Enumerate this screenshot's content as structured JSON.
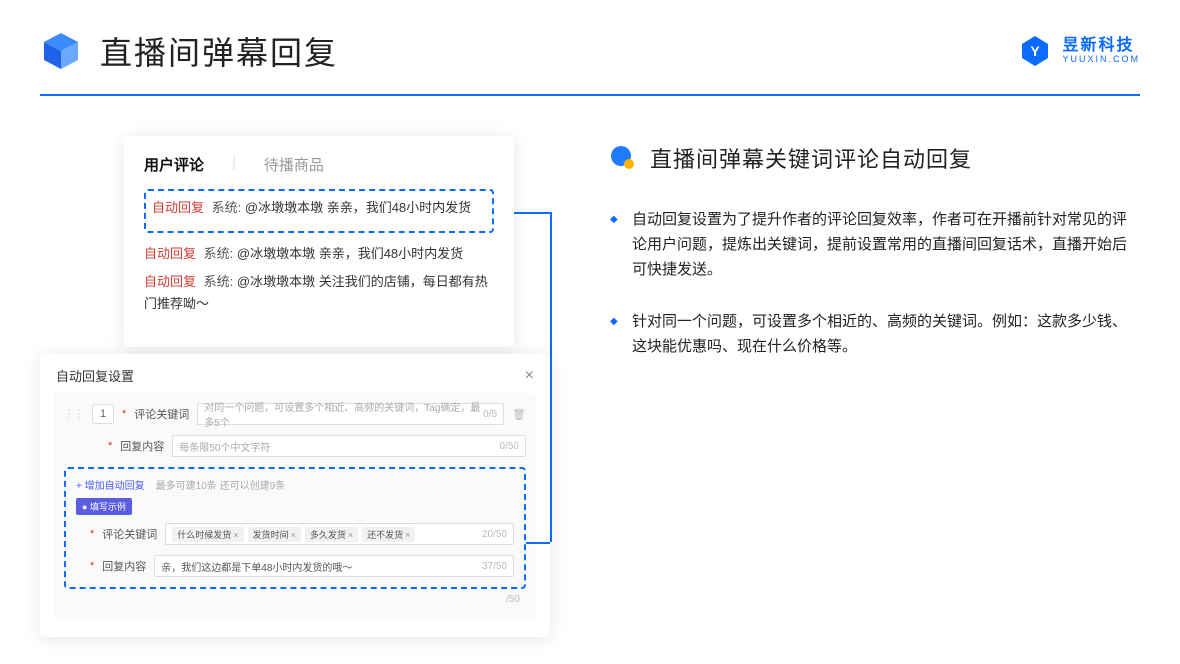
{
  "header": {
    "title": "直播间弹幕回复",
    "brand_name": "昱新科技",
    "brand_sub": "YUUXIN.COM"
  },
  "right": {
    "section_title": "直播间弹幕关键词评论自动回复",
    "bullet1": "自动回复设置为了提升作者的评论回复效率，作者可在开播前针对常见的评论用户问题，提炼出关键词，提前设置常用的直播间回复话术，直播开始后可快捷发送。",
    "bullet2": "针对同一个问题，可设置多个相近的、高频的关键词。例如：这款多少钱、这块能优惠吗、现在什么价格等。"
  },
  "comments": {
    "tab_active": "用户评论",
    "tab_inactive": "待播商品",
    "auto_tag": "自动回复",
    "sys_label": "系统:",
    "highlight_text": "@冰墩墩本墩 亲亲，我们48小时内发货",
    "line2": "@冰墩墩本墩 亲亲，我们48小时内发货",
    "line3": "@冰墩墩本墩 关注我们的店铺，每日都有热门推荐呦～"
  },
  "settings": {
    "title": "自动回复设置",
    "index": "1",
    "label_keyword": "评论关键词",
    "label_content": "回复内容",
    "ph_keyword": "对同一个问题，可设置多个相近、高频的关键词，Tag确定，最多5个",
    "ph_content": "每条限50个中文字符",
    "counter_kw": "0/5",
    "counter_ct": "0/50",
    "add_text": "+ 增加自动回复",
    "add_hint": "最多可建10条 还可以创建9条",
    "example_badge": "● 填写示例",
    "ex_kw_label": "评论关键词",
    "ex_tags": [
      "什么时候发货",
      "发货时间",
      "多久发货",
      "还不发货"
    ],
    "ex_kw_counter": "20/50",
    "ex_ct_label": "回复内容",
    "ex_ct_value": "亲，我们这边都是下单48小时内发货的哦～",
    "ex_ct_counter": "37/50",
    "extra_counter": "/50"
  }
}
